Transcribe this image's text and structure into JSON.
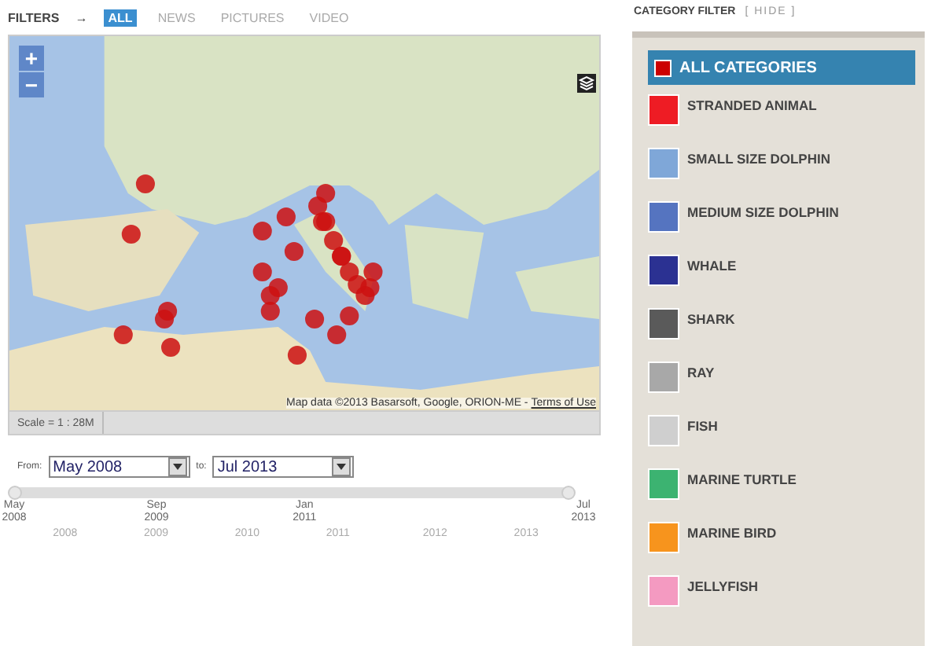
{
  "filters": {
    "label": "FILTERS",
    "arrow": "→",
    "tabs": [
      {
        "label": "ALL",
        "selected": true
      },
      {
        "label": "NEWS",
        "selected": false
      },
      {
        "label": "PICTURES",
        "selected": false
      },
      {
        "label": "VIDEO",
        "selected": false
      }
    ]
  },
  "map": {
    "zoom_in": "+",
    "zoom_out": "−",
    "attribution": "Map data ©2013 Basarsoft, Google, ORION-ME -",
    "terms": "Terms of Use",
    "scale": "Scale = 1 : 28M"
  },
  "date_range": {
    "from_label": "From:",
    "from": "May 2008",
    "to_label": "to:",
    "to": "Jul 2013"
  },
  "timeline": {
    "slider": {
      "start": {
        "level": 0
      },
      "end": {
        "level": 1
      }
    },
    "markers": [
      {
        "label": "May 2008"
      },
      {
        "label": "Sep 2009"
      },
      {
        "label": "Jan 2011"
      },
      {
        "label": "Jul 2013"
      }
    ],
    "years": [
      {
        "label": "2008"
      },
      {
        "label": "2009"
      },
      {
        "label": "2010"
      },
      {
        "label": "2011"
      },
      {
        "label": "2012"
      },
      {
        "label": "2013"
      }
    ]
  },
  "category_filter": {
    "title": "CATEGORY FILTER",
    "toggle": "[ HIDE ]",
    "items": [
      {
        "label": "ALL CATEGORIES",
        "selected": true,
        "color": "#cc0000"
      },
      {
        "label": "STRANDED ANIMAL",
        "selected": false,
        "color": "#ee1c24"
      },
      {
        "label": "SMALL SIZE DOLPHIN",
        "selected": false,
        "color": "#7fa7d8"
      },
      {
        "label": "MEDIUM SIZE DOLPHIN",
        "selected": false,
        "color": "#5574c0"
      },
      {
        "label": "WHALE",
        "selected": false,
        "color": "#2b3192"
      },
      {
        "label": "SHARK",
        "selected": false,
        "color": "#5a5a5a"
      },
      {
        "label": "RAY",
        "selected": false,
        "color": "#a8a8a8"
      },
      {
        "label": "FISH",
        "selected": false,
        "color": "#cfcfcf"
      },
      {
        "label": "MARINE TURTLE",
        "selected": false,
        "color": "#3cb371"
      },
      {
        "label": "MARINE BIRD",
        "selected": false,
        "color": "#f7941d"
      },
      {
        "label": "JELLYFISH",
        "selected": false,
        "color": "#f49ac1"
      }
    ]
  }
}
